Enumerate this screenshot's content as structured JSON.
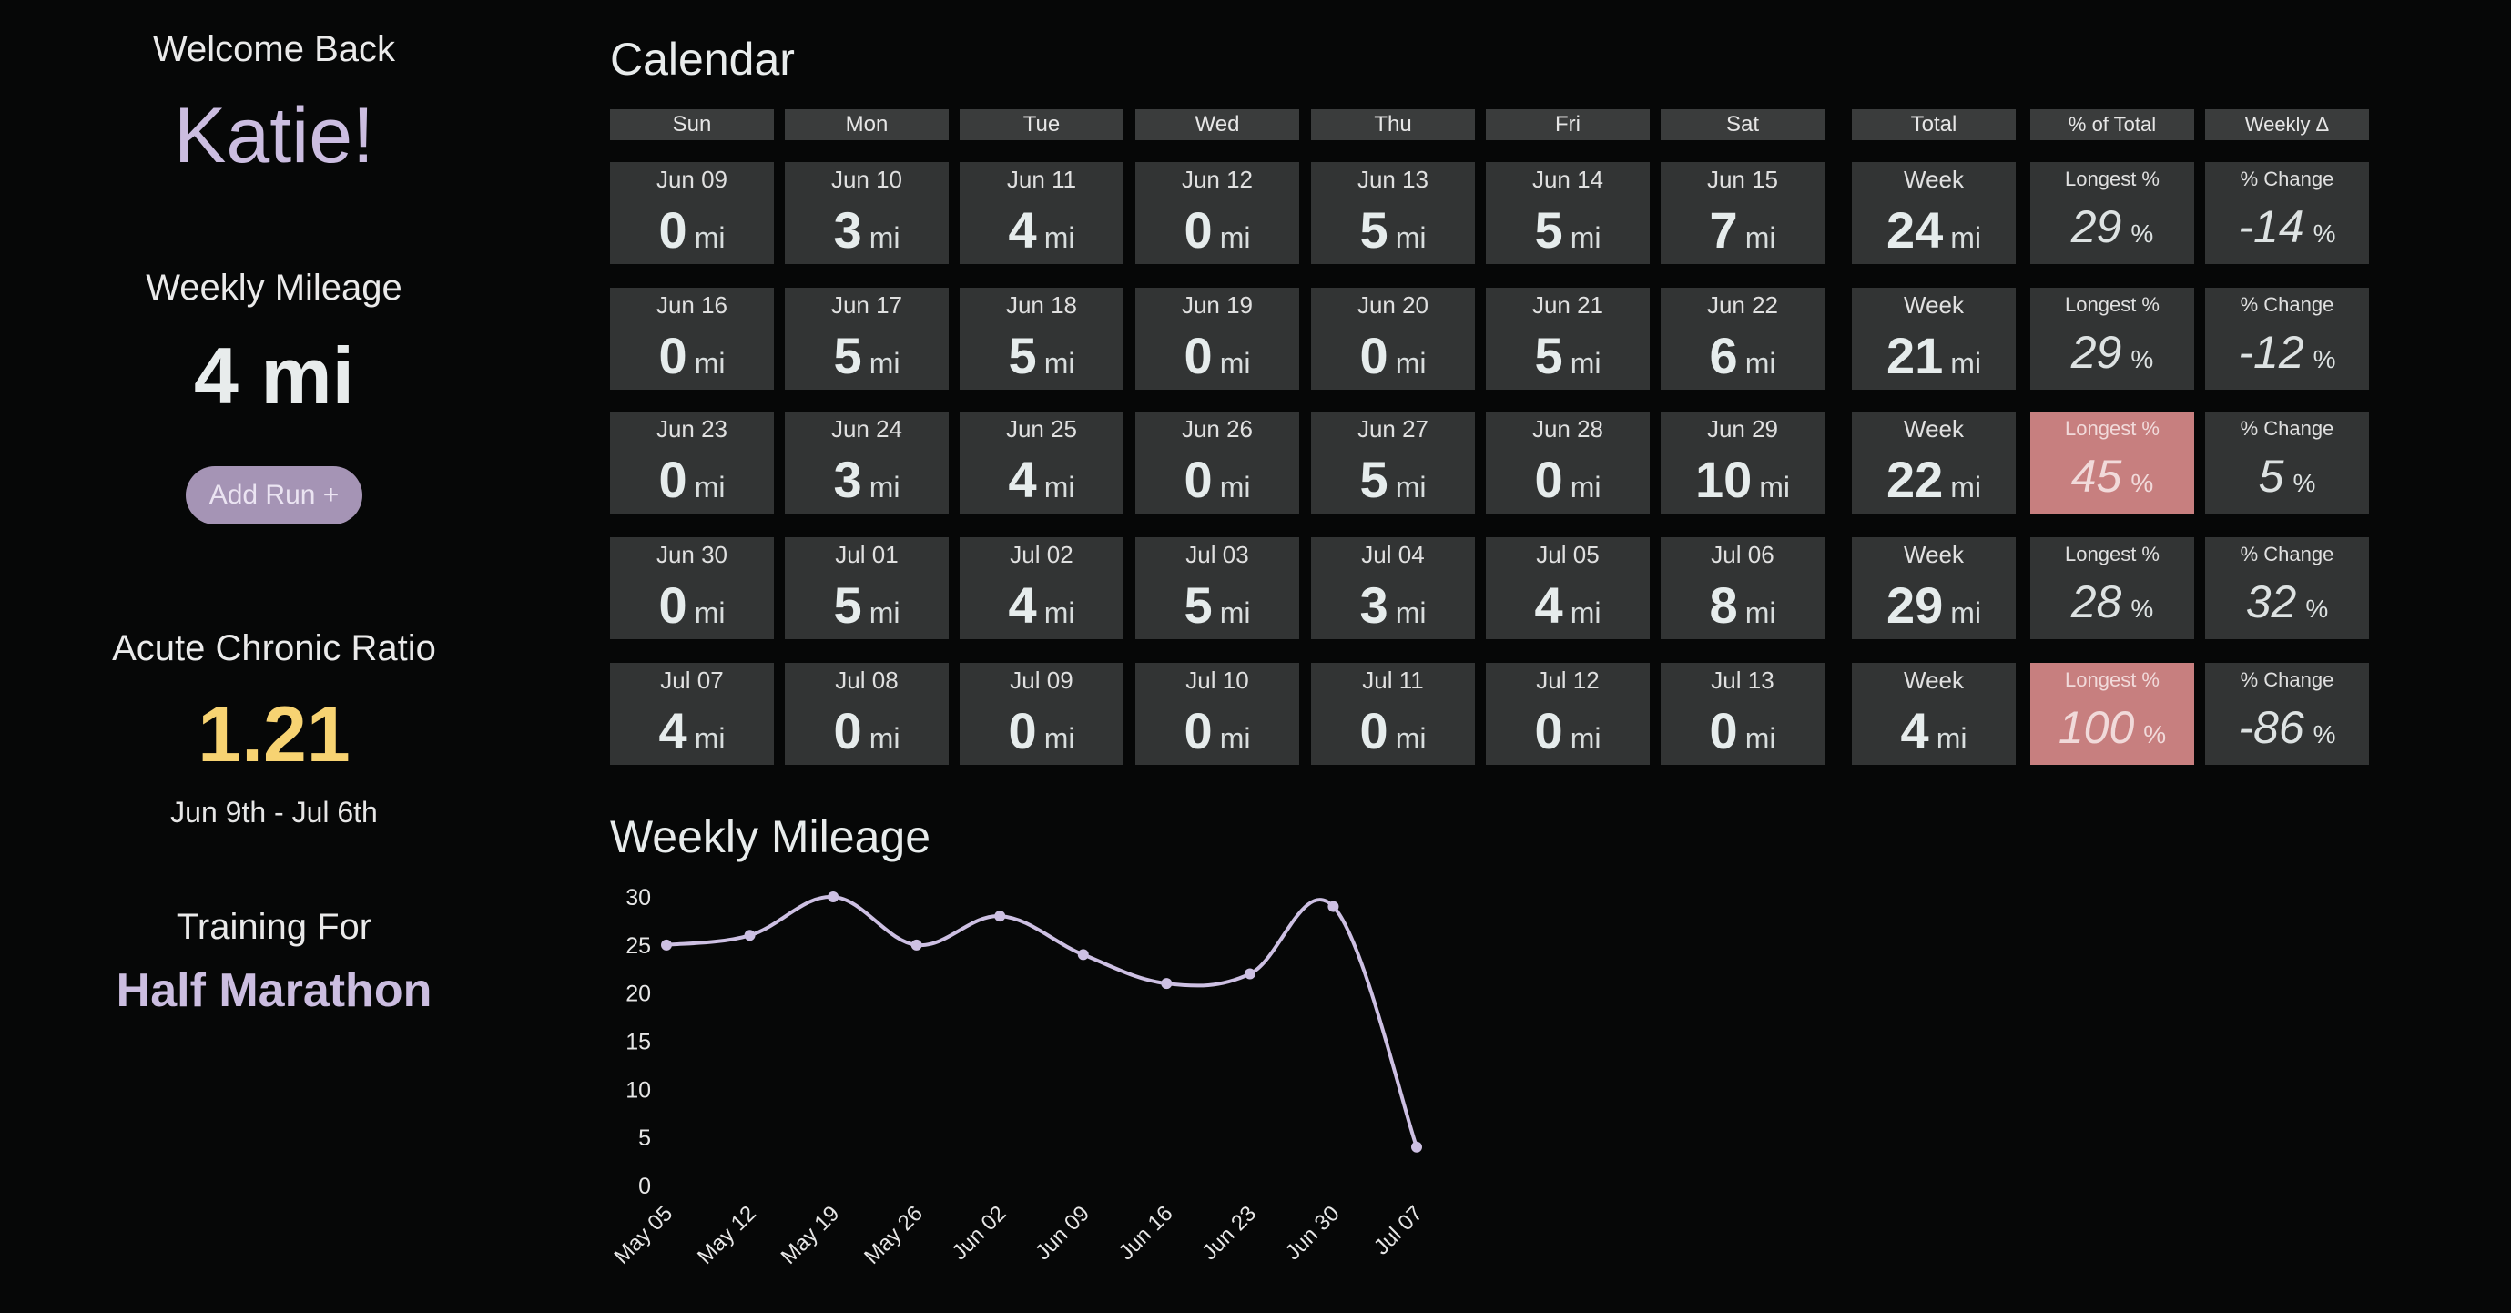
{
  "sidebar": {
    "welcome": "Welcome Back",
    "name": "Katie!",
    "weekly_mileage_label": "Weekly Mileage",
    "weekly_mileage_value": "4 mi",
    "add_run_label": "Add Run +",
    "acr_label": "Acute Chronic Ratio",
    "acr_value": "1.21",
    "acr_range": "Jun 9th - Jul 6th",
    "training_label": "Training For",
    "training_value": "Half Marathon"
  },
  "calendar": {
    "title": "Calendar",
    "headers": [
      "Sun",
      "Mon",
      "Tue",
      "Wed",
      "Thu",
      "Fri",
      "Sat",
      "Total",
      "% of Total",
      "Weekly Δ"
    ],
    "unit": "mi",
    "pct_unit": "%",
    "week_label": "Week",
    "longest_label": "Longest %",
    "change_label": "% Change",
    "weeks": [
      {
        "days": [
          [
            "Jun 09",
            "0"
          ],
          [
            "Jun 10",
            "3"
          ],
          [
            "Jun 11",
            "4"
          ],
          [
            "Jun 12",
            "0"
          ],
          [
            "Jun 13",
            "5"
          ],
          [
            "Jun 14",
            "5"
          ],
          [
            "Jun 15",
            "7"
          ]
        ],
        "total": "24",
        "longest": "29",
        "change": "-14",
        "warn": false
      },
      {
        "days": [
          [
            "Jun 16",
            "0"
          ],
          [
            "Jun 17",
            "5"
          ],
          [
            "Jun 18",
            "5"
          ],
          [
            "Jun 19",
            "0"
          ],
          [
            "Jun 20",
            "0"
          ],
          [
            "Jun 21",
            "5"
          ],
          [
            "Jun 22",
            "6"
          ]
        ],
        "total": "21",
        "longest": "29",
        "change": "-12",
        "warn": false
      },
      {
        "days": [
          [
            "Jun 23",
            "0"
          ],
          [
            "Jun 24",
            "3"
          ],
          [
            "Jun 25",
            "4"
          ],
          [
            "Jun 26",
            "0"
          ],
          [
            "Jun 27",
            "5"
          ],
          [
            "Jun 28",
            "0"
          ],
          [
            "Jun 29",
            "10"
          ]
        ],
        "total": "22",
        "longest": "45",
        "change": "5",
        "warn": true
      },
      {
        "days": [
          [
            "Jun 30",
            "0"
          ],
          [
            "Jul 01",
            "5"
          ],
          [
            "Jul 02",
            "4"
          ],
          [
            "Jul 03",
            "5"
          ],
          [
            "Jul 04",
            "3"
          ],
          [
            "Jul 05",
            "4"
          ],
          [
            "Jul 06",
            "8"
          ]
        ],
        "total": "29",
        "longest": "28",
        "change": "32",
        "warn": false
      },
      {
        "days": [
          [
            "Jul 07",
            "4"
          ],
          [
            "Jul 08",
            "0"
          ],
          [
            "Jul 09",
            "0"
          ],
          [
            "Jul 10",
            "0"
          ],
          [
            "Jul 11",
            "0"
          ],
          [
            "Jul 12",
            "0"
          ],
          [
            "Jul 13",
            "0"
          ]
        ],
        "total": "4",
        "longest": "100",
        "change": "-86",
        "warn": true
      }
    ]
  },
  "mileage_chart": {
    "title": "Weekly Mileage",
    "colors": {
      "line": "#cdc0e3",
      "warn": "#c77f7f",
      "accent": "#f7d372"
    }
  },
  "chart_data": {
    "type": "line",
    "x": [
      "May 05",
      "May 12",
      "May 19",
      "May 26",
      "Jun 02",
      "Jun 09",
      "Jun 16",
      "Jun 23",
      "Jun 30",
      "Jul 07"
    ],
    "series": [
      {
        "values": [
          25,
          26,
          30,
          25,
          28,
          24,
          21,
          22,
          29,
          4
        ]
      }
    ],
    "yticks": [
      0,
      5,
      10,
      15,
      20,
      25,
      30
    ],
    "ylim": [
      0,
      30
    ],
    "grid": false
  }
}
